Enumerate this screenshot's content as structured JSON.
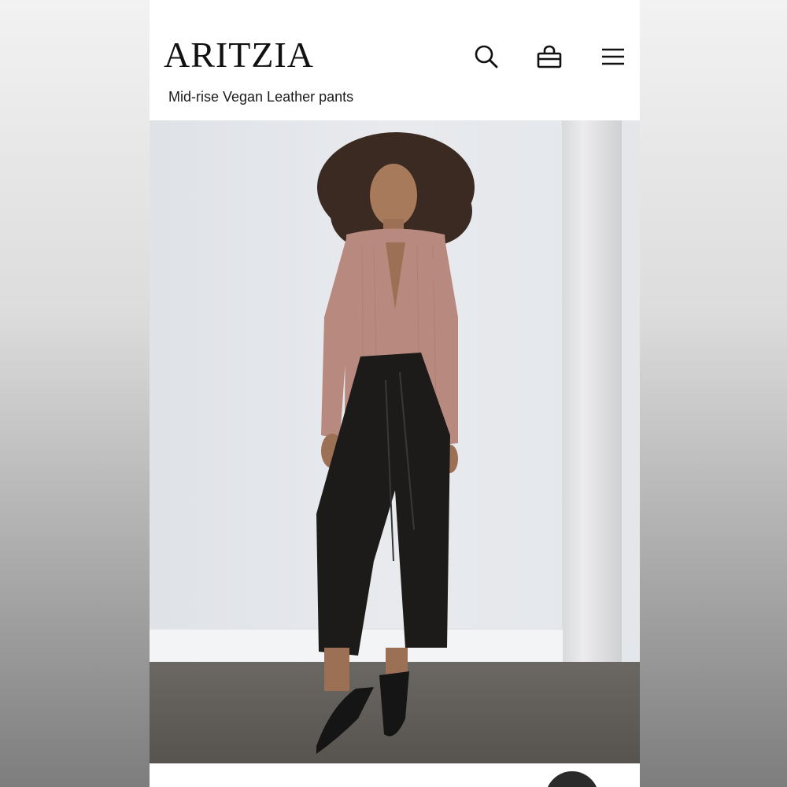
{
  "brand": {
    "name": "ARITZIA"
  },
  "product": {
    "title": "Mid-rise Vegan Leather pants"
  },
  "icons": {
    "search": "search-icon",
    "bag": "shopping-bag-icon",
    "menu": "hamburger-menu-icon",
    "chat": "chat-icon"
  },
  "colors": {
    "background": "#ffffff",
    "text": "#111111",
    "sweater": "#b8897f",
    "pants": "#1d1b1a"
  }
}
